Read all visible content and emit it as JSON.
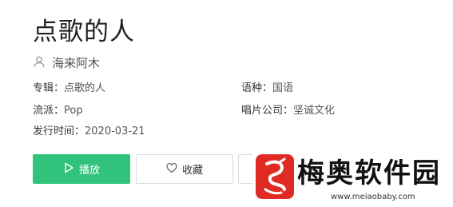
{
  "song": {
    "title": "点歌的人",
    "artist": "海来阿木"
  },
  "details": {
    "album_label": "专辑：",
    "album": "点歌的人",
    "language_label": "语种：",
    "language": "国语",
    "genre_label": "流派：",
    "genre": "Pop",
    "label_label": "唱片公司：",
    "label": "坚诚文化",
    "release_label": "发行时间：",
    "release": "2020-03-21"
  },
  "actions": {
    "play_label": "播放",
    "favorite_label": "收藏"
  },
  "watermark": {
    "brand": "梅奥软件园",
    "url": "www.meiaobaby.com"
  },
  "colors": {
    "accent": "#31c27c",
    "brand_red": "#e02b24"
  }
}
